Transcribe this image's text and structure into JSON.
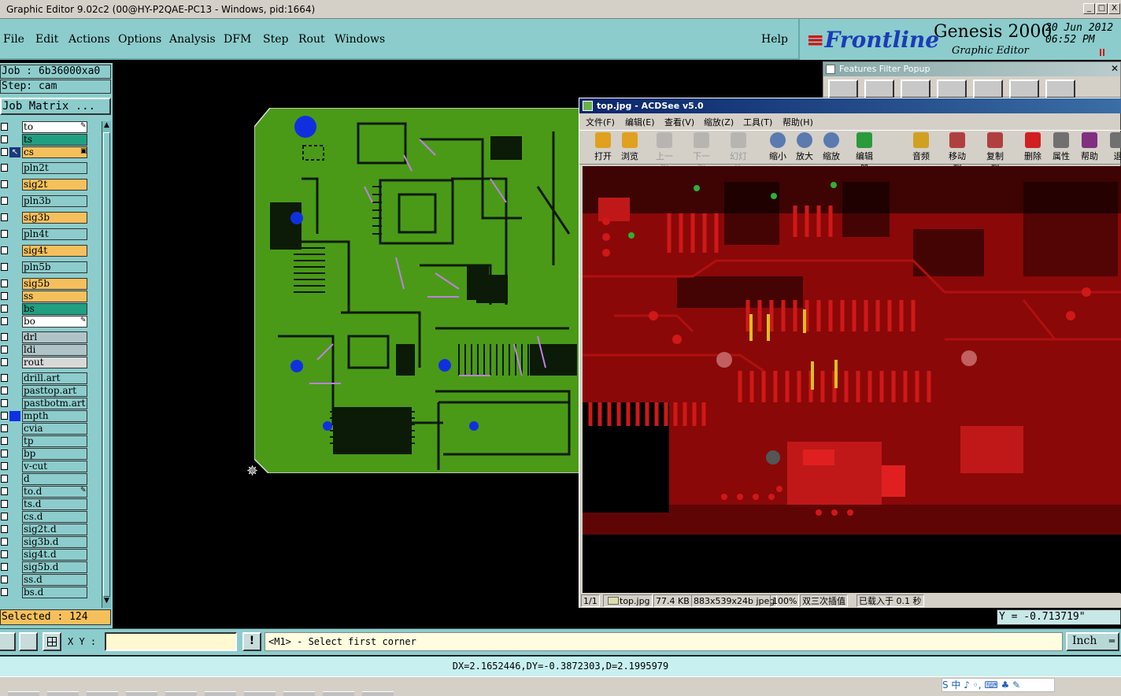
{
  "window": {
    "title": "Graphic Editor 9.02c2 (00@HY-P2QAE-PC13 - Windows, pid:1664)",
    "buttons": [
      "_",
      "□",
      "X"
    ]
  },
  "menubar": {
    "items": [
      "File",
      "Edit",
      "Actions",
      "Options",
      "Analysis",
      "DFM",
      "Step",
      "Rout",
      "Windows"
    ],
    "help": "Help"
  },
  "brand": {
    "logo": "Frontline",
    "product": "Genesis 2000",
    "subtitle": "Graphic Editor",
    "date": "20 Jun 2012",
    "time": "06:52 PM"
  },
  "left_panel": {
    "job": "Job : 6b36000xa0",
    "step": "Step: cam",
    "job_matrix": "Job Matrix ...",
    "selected": "Selected : 124",
    "layers": [
      {
        "name": "to",
        "color": "#ffffff",
        "flag": "✎"
      },
      {
        "name": "ts",
        "color": "#20a080",
        "flag": ""
      },
      {
        "name": "cs",
        "color": "#f5c05c",
        "flag": "▣",
        "active": true
      },
      {
        "name": "pln2t",
        "color": "#8ccccc",
        "flag": ""
      },
      {
        "name": "sig2t",
        "color": "#f5c05c",
        "flag": ""
      },
      {
        "name": "pln3b",
        "color": "#8ccccc",
        "flag": ""
      },
      {
        "name": "sig3b",
        "color": "#f5c05c",
        "flag": ""
      },
      {
        "name": "pln4t",
        "color": "#8ccccc",
        "flag": ""
      },
      {
        "name": "sig4t",
        "color": "#f5c05c",
        "flag": ""
      },
      {
        "name": "pln5b",
        "color": "#8ccccc",
        "flag": ""
      },
      {
        "name": "sig5b",
        "color": "#f5c05c",
        "flag": ""
      },
      {
        "name": "ss",
        "color": "#f5c05c",
        "flag": ""
      },
      {
        "name": "bs",
        "color": "#20a080",
        "flag": ""
      },
      {
        "name": "bo",
        "color": "#ffffff",
        "flag": "✎"
      },
      {
        "name": "drl",
        "color": "#b0c4c8",
        "flag": ""
      },
      {
        "name": "ldi",
        "color": "#b0c4c8",
        "flag": ""
      },
      {
        "name": "rout",
        "color": "#d8d8d8",
        "flag": ""
      },
      {
        "name": "drill.art",
        "color": "#8ccccc",
        "flag": ""
      },
      {
        "name": "pasttop.art",
        "color": "#8ccccc",
        "flag": ""
      },
      {
        "name": "pastbotm.art",
        "color": "#8ccccc",
        "flag": ""
      },
      {
        "name": "mpth",
        "color": "#8ccccc",
        "flag": "",
        "mark": "#1030e0"
      },
      {
        "name": "cvia",
        "color": "#8ccccc",
        "flag": ""
      },
      {
        "name": "tp",
        "color": "#8ccccc",
        "flag": ""
      },
      {
        "name": "bp",
        "color": "#8ccccc",
        "flag": ""
      },
      {
        "name": "v-cut",
        "color": "#8ccccc",
        "flag": ""
      },
      {
        "name": "d",
        "color": "#8ccccc",
        "flag": ""
      },
      {
        "name": "to.d",
        "color": "#8ccccc",
        "flag": "✎"
      },
      {
        "name": "ts.d",
        "color": "#8ccccc",
        "flag": ""
      },
      {
        "name": "cs.d",
        "color": "#8ccccc",
        "flag": ""
      },
      {
        "name": "sig2t.d",
        "color": "#8ccccc",
        "flag": ""
      },
      {
        "name": "sig3b.d",
        "color": "#8ccccc",
        "flag": ""
      },
      {
        "name": "sig4t.d",
        "color": "#8ccccc",
        "flag": ""
      },
      {
        "name": "sig5b.d",
        "color": "#8ccccc",
        "flag": ""
      },
      {
        "name": "ss.d",
        "color": "#8ccccc",
        "flag": ""
      },
      {
        "name": "bs.d",
        "color": "#8ccccc",
        "flag": ""
      }
    ]
  },
  "features_popup": {
    "title": "Features Filter Popup"
  },
  "acdsee": {
    "title": "top.jpg - ACDSee v5.0",
    "menus": [
      "文件(F)",
      "编辑(E)",
      "查看(V)",
      "缩放(Z)",
      "工具(T)",
      "帮助(H)"
    ],
    "tools": [
      {
        "label": "打开",
        "disabled": false
      },
      {
        "label": "浏览",
        "disabled": false
      },
      {
        "label": "上一张",
        "disabled": true
      },
      {
        "label": "下一张",
        "disabled": true
      },
      {
        "label": "幻灯片",
        "disabled": true
      },
      {
        "label": "缩小",
        "disabled": false
      },
      {
        "label": "放大",
        "disabled": false
      },
      {
        "label": "缩放",
        "disabled": false
      },
      {
        "label": "编辑器",
        "disabled": false
      },
      {
        "label": "音频",
        "disabled": false
      },
      {
        "label": "移动到",
        "disabled": false
      },
      {
        "label": "复制到",
        "disabled": false
      },
      {
        "label": "删除",
        "disabled": false
      },
      {
        "label": "属性",
        "disabled": false
      },
      {
        "label": "帮助",
        "disabled": false
      },
      {
        "label": "退",
        "disabled": false
      }
    ],
    "status": [
      "1/1",
      "top.jpg",
      "77.4 KB",
      "883x539x24b jpeg",
      "100%",
      "双三次插值",
      "已载入于 0.1 秒"
    ]
  },
  "readout": {
    "y": "Y = -0.713719\""
  },
  "command": {
    "xy_label": "X Y :",
    "xy_value": "",
    "prompt": "<M1> - Select first corner",
    "unit": "Inch",
    "measure": "DX=2.1652446,DY=-0.3872303,D=2.1995979"
  },
  "ime": {
    "text": "S 中 ♪ ◦, ⌨ ♣ ✎"
  },
  "colors": {
    "panel": "#8ccccc",
    "board_green": "#4a9a18",
    "board_red": "#8a0808",
    "via_blue": "#1030e0",
    "trace_purple": "#c080e0"
  }
}
